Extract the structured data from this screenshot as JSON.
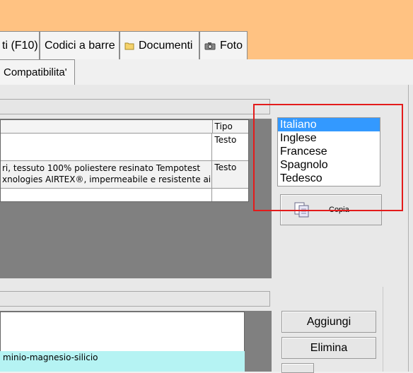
{
  "tabs": [
    {
      "label": "ti (F10)"
    },
    {
      "label": "Codici a barre"
    },
    {
      "label": "Documenti",
      "icon": "folder-icon"
    },
    {
      "label": "Foto",
      "icon": "camera-icon"
    }
  ],
  "subtab": {
    "label": "Compatibilita'"
  },
  "grid": {
    "header": {
      "col2": "Tipo"
    },
    "rows": [
      {
        "line1": "",
        "line2": "",
        "tipo": "Testo"
      },
      {
        "line1": "ri, tessuto 100% poliestere resinato Tempotest",
        "line2": "xnologies AIRTEX®, impermeabile e resistente ai ...",
        "tipo": "Testo"
      },
      {
        "line1": "",
        "line2": "",
        "tipo": ""
      }
    ]
  },
  "languages": {
    "items": [
      "Italiano",
      "Inglese",
      "Francese",
      "Spagnolo",
      "Tedesco"
    ],
    "selected": "Italiano"
  },
  "buttons": {
    "copia": "Copia",
    "aggiungi": "Aggiungi",
    "elimina": "Elimina"
  },
  "lower": {
    "row_text": "minio-magnesio-silicio"
  },
  "colors": {
    "accent_band": "#ffc282",
    "selection": "#3399ff",
    "highlight_box": "#e31b1b",
    "lower_row": "#b5f3f3"
  }
}
